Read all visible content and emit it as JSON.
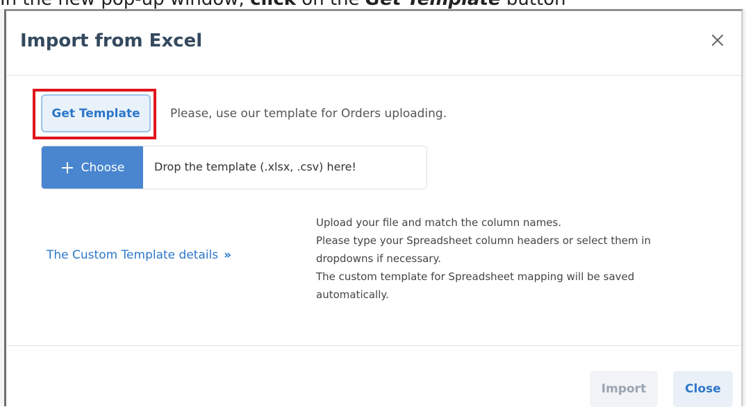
{
  "caption": {
    "pre": "In the new pop-up window, ",
    "click": "click",
    "mid": " on the ",
    "target": "Get Template",
    "post": " button"
  },
  "dialog": {
    "title": "Import from Excel",
    "close_icon": "close-icon"
  },
  "template": {
    "get_template_label": "Get Template",
    "hint": "Please, use our template for Orders uploading."
  },
  "upload": {
    "choose_label": "Choose",
    "choose_icon": "plus-icon",
    "drop_text": "Drop the template (.xlsx, .csv) here!"
  },
  "custom": {
    "link_label": "The Custom Template details",
    "link_icon": "double-chevron-right-icon"
  },
  "info": {
    "lines": [
      "Upload your file and match the column names.",
      "Please type your Spreadsheet column headers or select them in",
      "dropdowns if necessary.",
      "The custom template for Spreadsheet mapping will be saved",
      "automatically."
    ]
  },
  "footer": {
    "import_label": "Import",
    "close_label": "Close"
  },
  "colors": {
    "accent": "#2d77c9",
    "choose_bg": "#4a86cf",
    "highlight": "#e0141c",
    "title": "#34495e"
  }
}
